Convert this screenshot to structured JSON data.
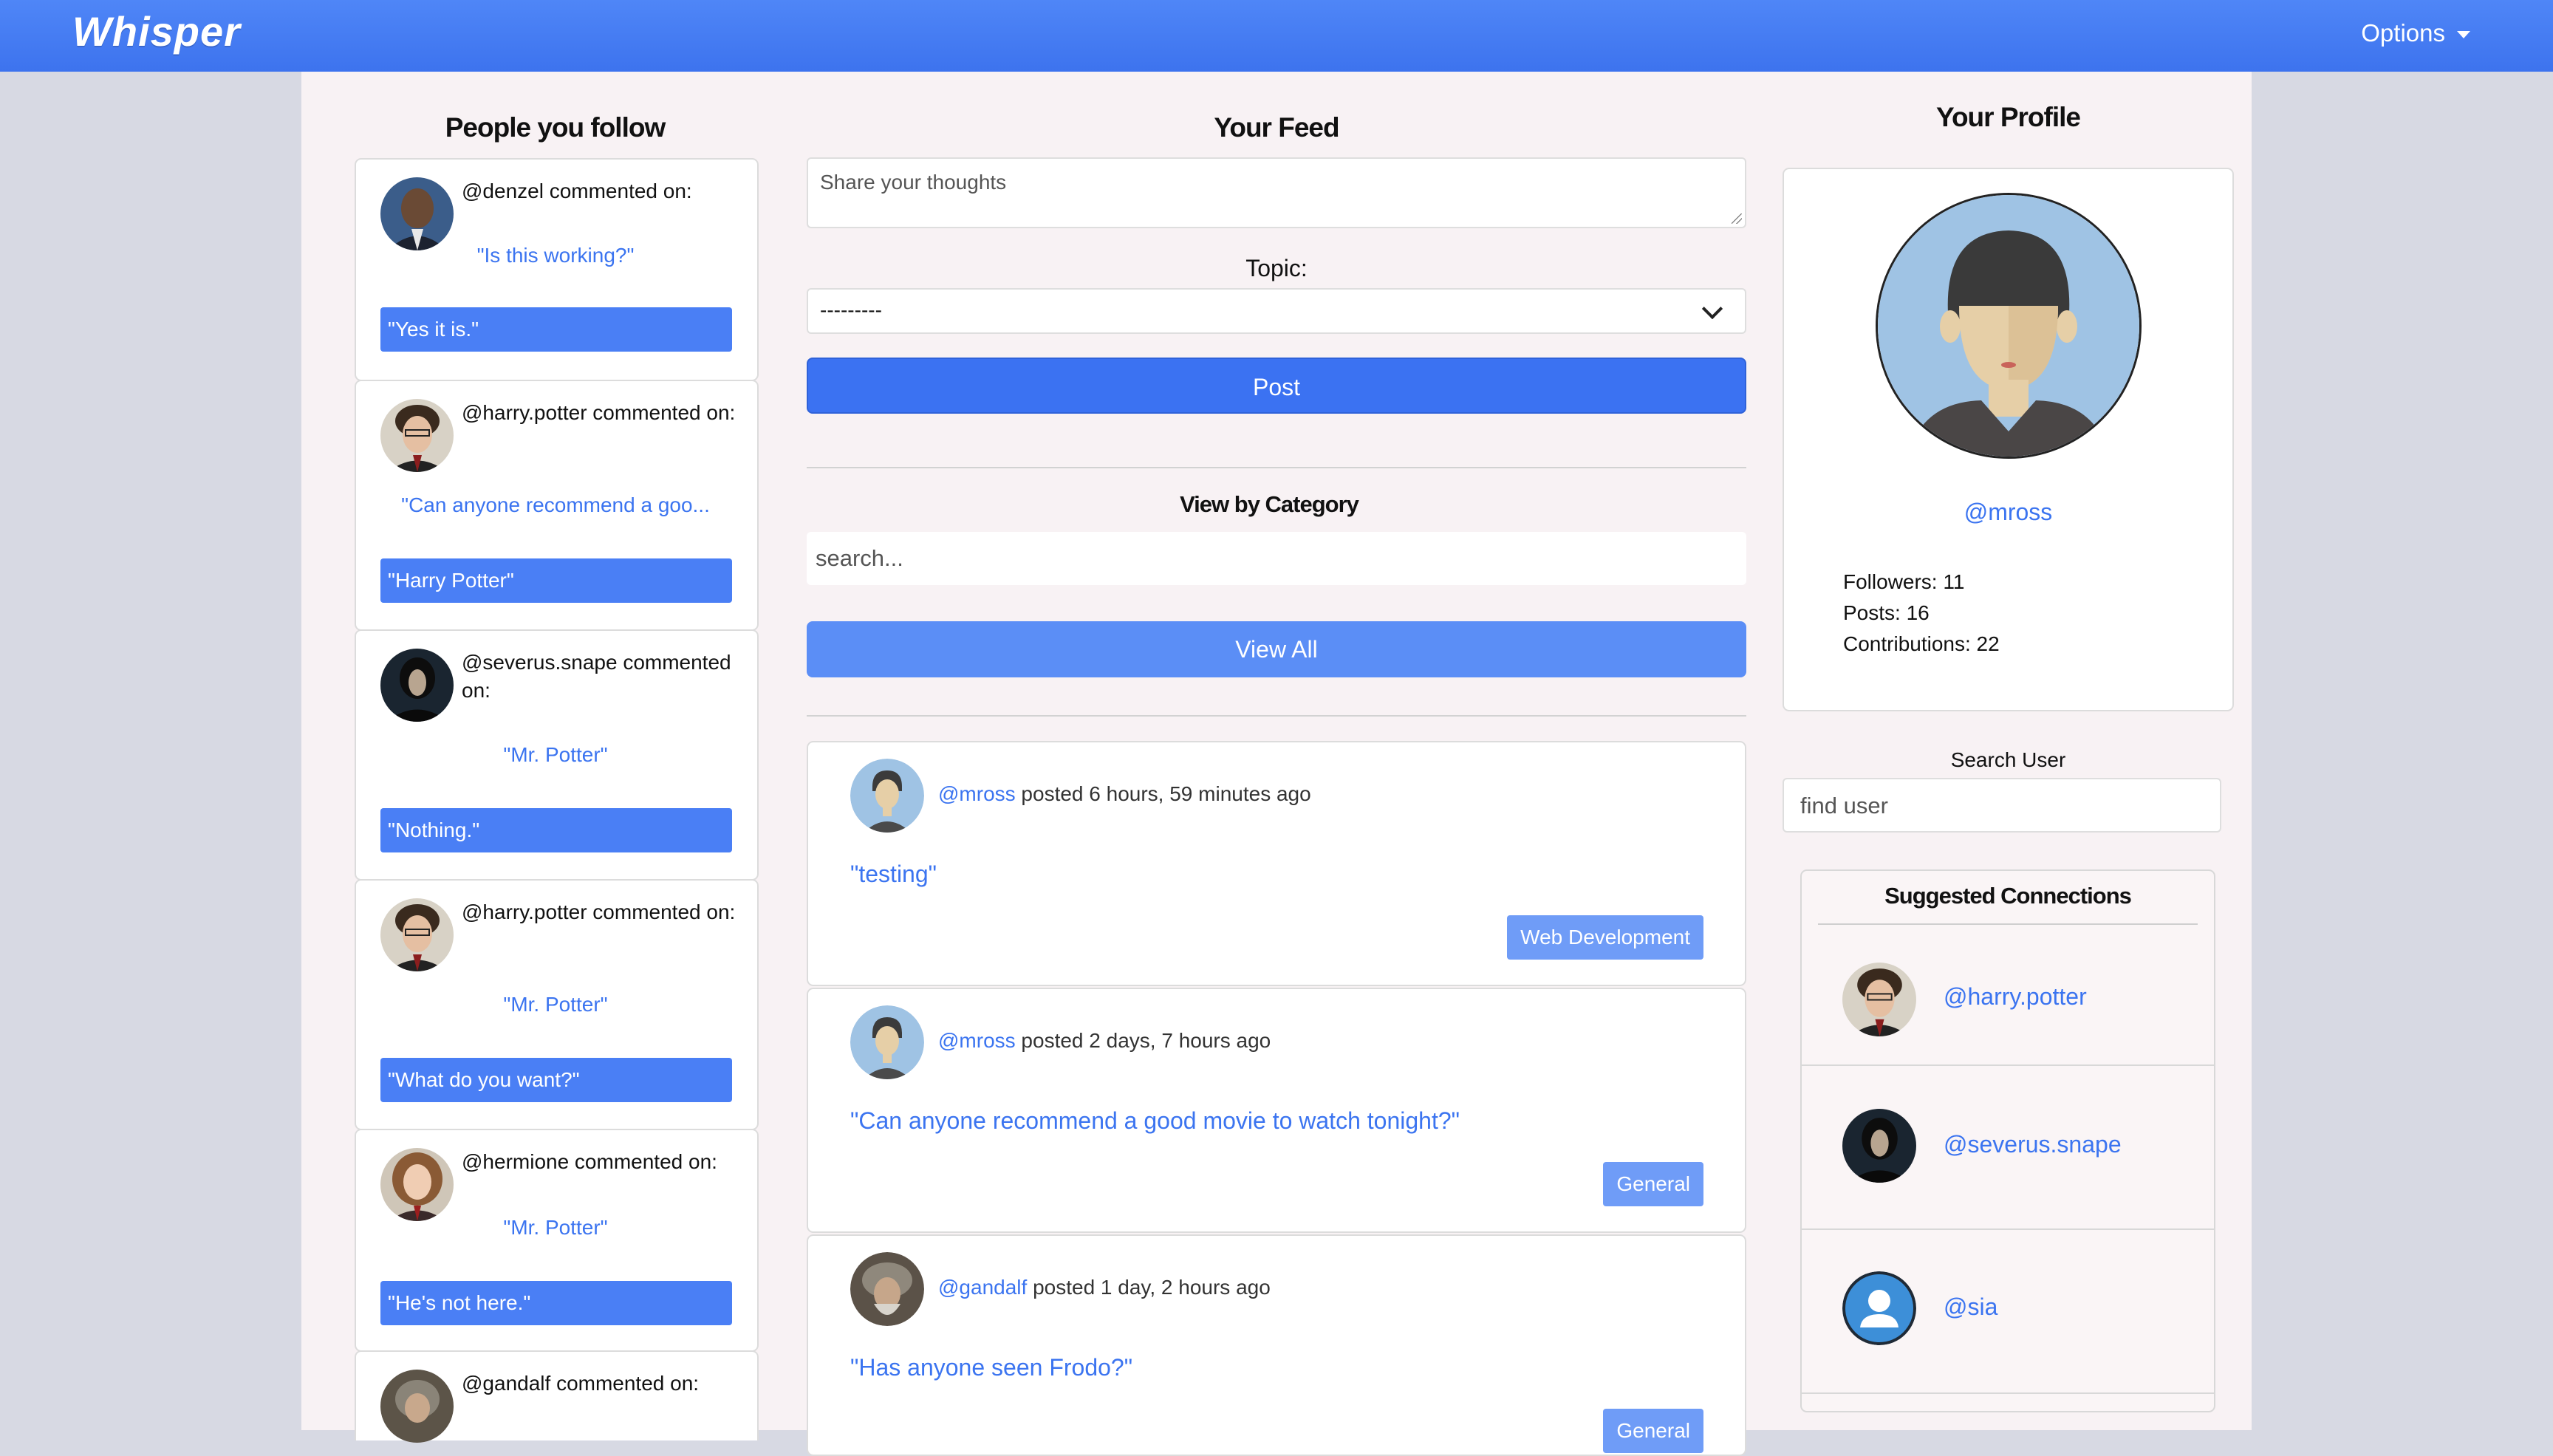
{
  "brand": "Whisper",
  "nav": {
    "options_label": "Options"
  },
  "left": {
    "title": "People you follow",
    "cards": [
      {
        "who": "@denzel commented on:",
        "quote": "\"Is this working?\"",
        "reply": "\"Yes it is.\""
      },
      {
        "who": "@harry.potter commented on:",
        "quote": "\"Can anyone recommend a goo...",
        "reply": "\"Harry Potter\""
      },
      {
        "who": "@severus.snape commented on:",
        "quote": "\"Mr. Potter\"",
        "reply": "\"Nothing.\""
      },
      {
        "who": "@harry.potter commented on:",
        "quote": "\"Mr. Potter\"",
        "reply": "\"What do you want?\""
      },
      {
        "who": "@hermione commented on:",
        "quote": "\"Mr. Potter\"",
        "reply": "\"He's not here.\""
      },
      {
        "who": "@gandalf commented on:",
        "quote": "",
        "reply": ""
      }
    ]
  },
  "feed": {
    "title": "Your Feed",
    "textarea_placeholder": "Share your thoughts",
    "topic_label": "Topic:",
    "topic_value": "---------",
    "post_button": "Post",
    "category_title": "View by Category",
    "search_placeholder": "search...",
    "view_all_button": "View All",
    "posts": [
      {
        "user": "@mross",
        "time": " posted 6 hours, 59 minutes ago",
        "text": "\"testing\"",
        "tag": "Web Development"
      },
      {
        "user": "@mross",
        "time": " posted 2 days, 7 hours ago",
        "text": "\"Can anyone recommend a good movie to watch tonight?\"",
        "tag": "General"
      },
      {
        "user": "@gandalf",
        "time": " posted 1 day, 2 hours ago",
        "text": "\"Has anyone seen Frodo?\"",
        "tag": "General"
      }
    ]
  },
  "profile": {
    "title": "Your Profile",
    "handle": "@mross",
    "followers": "Followers: 11",
    "posts": "Posts: 16",
    "contributions": "Contributions: 22",
    "search_label": "Search User",
    "search_placeholder": "find user",
    "suggest_title": "Suggested Connections",
    "suggestions": [
      {
        "handle": "@harry.potter"
      },
      {
        "handle": "@severus.snape"
      },
      {
        "handle": "@sia"
      }
    ]
  },
  "colors": {
    "accent": "#3b72f2",
    "link": "#3b74f0",
    "navbar": "#4a7ff5",
    "page_bg": "#f8f2f4"
  }
}
